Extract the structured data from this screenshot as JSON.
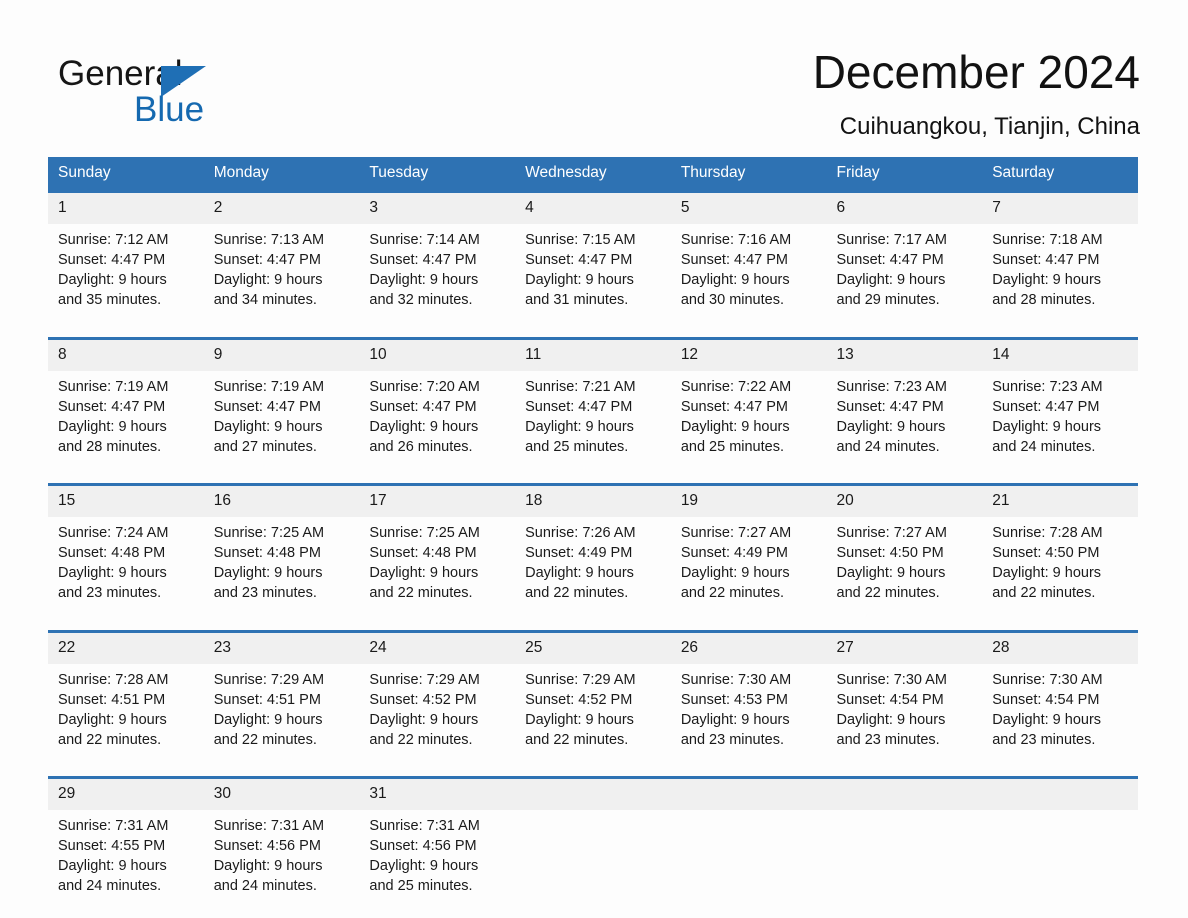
{
  "brand": {
    "name_top": "General",
    "name_bottom": "Blue",
    "accent_color": "#1f6fb5",
    "triangle_icon": "logo-triangle-icon"
  },
  "header": {
    "month_title": "December 2024",
    "location": "Cuihuangkou, Tianjin, China"
  },
  "theme": {
    "header_bg": "#2e72b3",
    "row_border": "#2e72b3",
    "daynum_bg": "#f0f0f0",
    "page_bg": "#fdfdfd",
    "text": "#1a1a1a"
  },
  "weekday_headers": [
    "Sunday",
    "Monday",
    "Tuesday",
    "Wednesday",
    "Thursday",
    "Friday",
    "Saturday"
  ],
  "weeks": [
    [
      {
        "day": "1",
        "sunrise": "Sunrise: 7:12 AM",
        "sunset": "Sunset: 4:47 PM",
        "daylight_1": "Daylight: 9 hours",
        "daylight_2": "and 35 minutes."
      },
      {
        "day": "2",
        "sunrise": "Sunrise: 7:13 AM",
        "sunset": "Sunset: 4:47 PM",
        "daylight_1": "Daylight: 9 hours",
        "daylight_2": "and 34 minutes."
      },
      {
        "day": "3",
        "sunrise": "Sunrise: 7:14 AM",
        "sunset": "Sunset: 4:47 PM",
        "daylight_1": "Daylight: 9 hours",
        "daylight_2": "and 32 minutes."
      },
      {
        "day": "4",
        "sunrise": "Sunrise: 7:15 AM",
        "sunset": "Sunset: 4:47 PM",
        "daylight_1": "Daylight: 9 hours",
        "daylight_2": "and 31 minutes."
      },
      {
        "day": "5",
        "sunrise": "Sunrise: 7:16 AM",
        "sunset": "Sunset: 4:47 PM",
        "daylight_1": "Daylight: 9 hours",
        "daylight_2": "and 30 minutes."
      },
      {
        "day": "6",
        "sunrise": "Sunrise: 7:17 AM",
        "sunset": "Sunset: 4:47 PM",
        "daylight_1": "Daylight: 9 hours",
        "daylight_2": "and 29 minutes."
      },
      {
        "day": "7",
        "sunrise": "Sunrise: 7:18 AM",
        "sunset": "Sunset: 4:47 PM",
        "daylight_1": "Daylight: 9 hours",
        "daylight_2": "and 28 minutes."
      }
    ],
    [
      {
        "day": "8",
        "sunrise": "Sunrise: 7:19 AM",
        "sunset": "Sunset: 4:47 PM",
        "daylight_1": "Daylight: 9 hours",
        "daylight_2": "and 28 minutes."
      },
      {
        "day": "9",
        "sunrise": "Sunrise: 7:19 AM",
        "sunset": "Sunset: 4:47 PM",
        "daylight_1": "Daylight: 9 hours",
        "daylight_2": "and 27 minutes."
      },
      {
        "day": "10",
        "sunrise": "Sunrise: 7:20 AM",
        "sunset": "Sunset: 4:47 PM",
        "daylight_1": "Daylight: 9 hours",
        "daylight_2": "and 26 minutes."
      },
      {
        "day": "11",
        "sunrise": "Sunrise: 7:21 AM",
        "sunset": "Sunset: 4:47 PM",
        "daylight_1": "Daylight: 9 hours",
        "daylight_2": "and 25 minutes."
      },
      {
        "day": "12",
        "sunrise": "Sunrise: 7:22 AM",
        "sunset": "Sunset: 4:47 PM",
        "daylight_1": "Daylight: 9 hours",
        "daylight_2": "and 25 minutes."
      },
      {
        "day": "13",
        "sunrise": "Sunrise: 7:23 AM",
        "sunset": "Sunset: 4:47 PM",
        "daylight_1": "Daylight: 9 hours",
        "daylight_2": "and 24 minutes."
      },
      {
        "day": "14",
        "sunrise": "Sunrise: 7:23 AM",
        "sunset": "Sunset: 4:47 PM",
        "daylight_1": "Daylight: 9 hours",
        "daylight_2": "and 24 minutes."
      }
    ],
    [
      {
        "day": "15",
        "sunrise": "Sunrise: 7:24 AM",
        "sunset": "Sunset: 4:48 PM",
        "daylight_1": "Daylight: 9 hours",
        "daylight_2": "and 23 minutes."
      },
      {
        "day": "16",
        "sunrise": "Sunrise: 7:25 AM",
        "sunset": "Sunset: 4:48 PM",
        "daylight_1": "Daylight: 9 hours",
        "daylight_2": "and 23 minutes."
      },
      {
        "day": "17",
        "sunrise": "Sunrise: 7:25 AM",
        "sunset": "Sunset: 4:48 PM",
        "daylight_1": "Daylight: 9 hours",
        "daylight_2": "and 22 minutes."
      },
      {
        "day": "18",
        "sunrise": "Sunrise: 7:26 AM",
        "sunset": "Sunset: 4:49 PM",
        "daylight_1": "Daylight: 9 hours",
        "daylight_2": "and 22 minutes."
      },
      {
        "day": "19",
        "sunrise": "Sunrise: 7:27 AM",
        "sunset": "Sunset: 4:49 PM",
        "daylight_1": "Daylight: 9 hours",
        "daylight_2": "and 22 minutes."
      },
      {
        "day": "20",
        "sunrise": "Sunrise: 7:27 AM",
        "sunset": "Sunset: 4:50 PM",
        "daylight_1": "Daylight: 9 hours",
        "daylight_2": "and 22 minutes."
      },
      {
        "day": "21",
        "sunrise": "Sunrise: 7:28 AM",
        "sunset": "Sunset: 4:50 PM",
        "daylight_1": "Daylight: 9 hours",
        "daylight_2": "and 22 minutes."
      }
    ],
    [
      {
        "day": "22",
        "sunrise": "Sunrise: 7:28 AM",
        "sunset": "Sunset: 4:51 PM",
        "daylight_1": "Daylight: 9 hours",
        "daylight_2": "and 22 minutes."
      },
      {
        "day": "23",
        "sunrise": "Sunrise: 7:29 AM",
        "sunset": "Sunset: 4:51 PM",
        "daylight_1": "Daylight: 9 hours",
        "daylight_2": "and 22 minutes."
      },
      {
        "day": "24",
        "sunrise": "Sunrise: 7:29 AM",
        "sunset": "Sunset: 4:52 PM",
        "daylight_1": "Daylight: 9 hours",
        "daylight_2": "and 22 minutes."
      },
      {
        "day": "25",
        "sunrise": "Sunrise: 7:29 AM",
        "sunset": "Sunset: 4:52 PM",
        "daylight_1": "Daylight: 9 hours",
        "daylight_2": "and 22 minutes."
      },
      {
        "day": "26",
        "sunrise": "Sunrise: 7:30 AM",
        "sunset": "Sunset: 4:53 PM",
        "daylight_1": "Daylight: 9 hours",
        "daylight_2": "and 23 minutes."
      },
      {
        "day": "27",
        "sunrise": "Sunrise: 7:30 AM",
        "sunset": "Sunset: 4:54 PM",
        "daylight_1": "Daylight: 9 hours",
        "daylight_2": "and 23 minutes."
      },
      {
        "day": "28",
        "sunrise": "Sunrise: 7:30 AM",
        "sunset": "Sunset: 4:54 PM",
        "daylight_1": "Daylight: 9 hours",
        "daylight_2": "and 23 minutes."
      }
    ],
    [
      {
        "day": "29",
        "sunrise": "Sunrise: 7:31 AM",
        "sunset": "Sunset: 4:55 PM",
        "daylight_1": "Daylight: 9 hours",
        "daylight_2": "and 24 minutes."
      },
      {
        "day": "30",
        "sunrise": "Sunrise: 7:31 AM",
        "sunset": "Sunset: 4:56 PM",
        "daylight_1": "Daylight: 9 hours",
        "daylight_2": "and 24 minutes."
      },
      {
        "day": "31",
        "sunrise": "Sunrise: 7:31 AM",
        "sunset": "Sunset: 4:56 PM",
        "daylight_1": "Daylight: 9 hours",
        "daylight_2": "and 25 minutes."
      },
      {
        "day": "",
        "sunrise": "",
        "sunset": "",
        "daylight_1": "",
        "daylight_2": ""
      },
      {
        "day": "",
        "sunrise": "",
        "sunset": "",
        "daylight_1": "",
        "daylight_2": ""
      },
      {
        "day": "",
        "sunrise": "",
        "sunset": "",
        "daylight_1": "",
        "daylight_2": ""
      },
      {
        "day": "",
        "sunrise": "",
        "sunset": "",
        "daylight_1": "",
        "daylight_2": ""
      }
    ]
  ]
}
